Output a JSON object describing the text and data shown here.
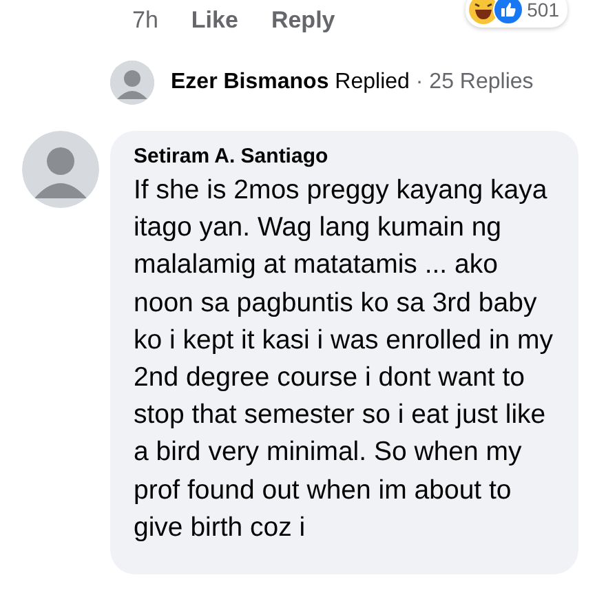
{
  "previous_comment": {
    "time": "7h",
    "actions": [
      "Like",
      "Reply"
    ],
    "reaction_count": "501"
  },
  "reply_summary": {
    "name": "Ezer Bismanos",
    "action": "Replied",
    "separator": "·",
    "count": "25 Replies"
  },
  "comment": {
    "author": "Setiram A. Santiago",
    "text": "If she is 2mos preggy kayang kaya itago yan. Wag lang kumain ng malalamig at matatamis ... ako noon sa pagbuntis ko sa 3rd baby ko i kept it kasi i was enrolled in my 2nd degree course i dont want to stop that semester so i eat just like a bird very minimal. So when my prof found out when im about to give birth coz i"
  }
}
